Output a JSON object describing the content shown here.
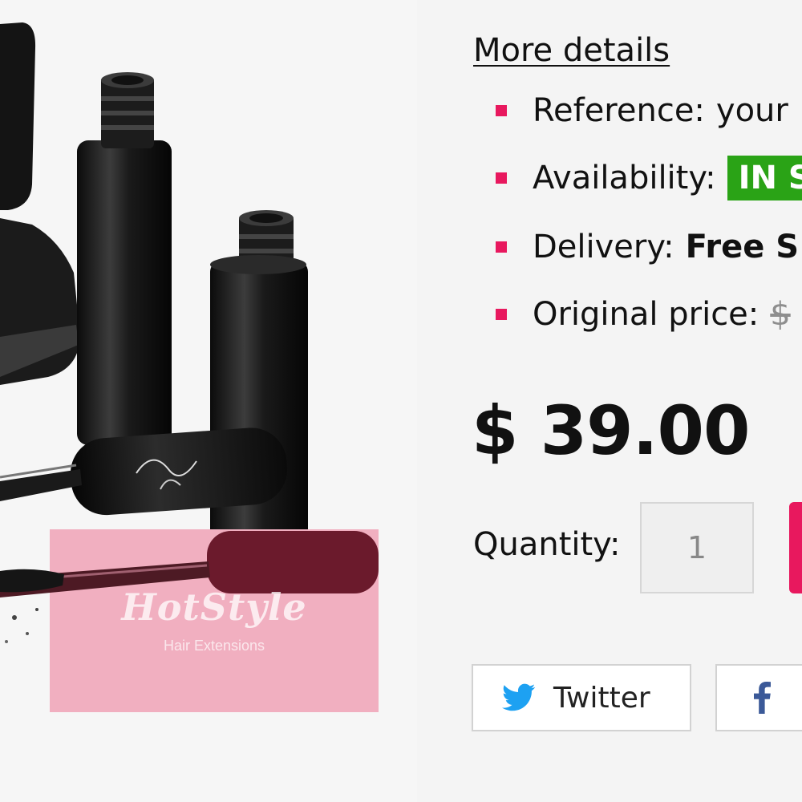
{
  "product": {
    "watermark_brand": "HotStyle",
    "watermark_sub": "Hair Extensions"
  },
  "details": {
    "more_details_link": "More details",
    "items": [
      {
        "key": "Reference:",
        "value": "your"
      },
      {
        "key": "Availability:",
        "value": "IN S"
      },
      {
        "key": "Delivery:",
        "value": "Free S"
      },
      {
        "key": "Original price:",
        "value": "$"
      }
    ]
  },
  "price": "$ 39.00",
  "quantity": {
    "label": "Quantity:",
    "value": "1"
  },
  "share": {
    "twitter_label": "Twitter",
    "twitter_icon": "twitter-bird-icon",
    "facebook_icon": "facebook-f-icon"
  },
  "colors": {
    "accent": "#e8185e",
    "in_stock": "#2aa316",
    "twitter_blue": "#1da1f2",
    "facebook_blue": "#3b5998"
  }
}
